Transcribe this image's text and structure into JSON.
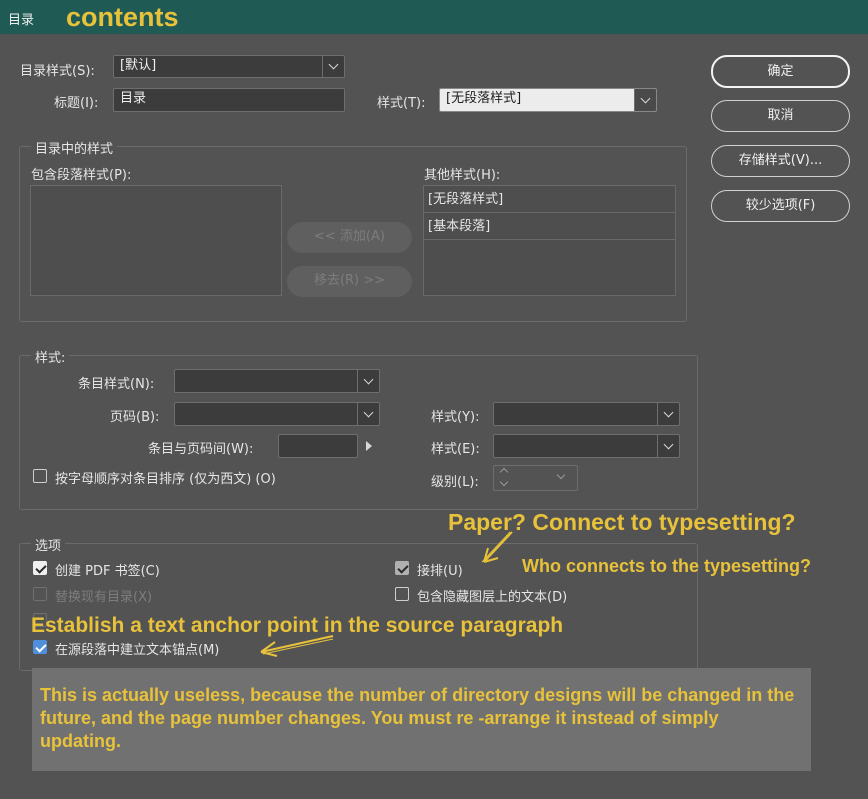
{
  "window": {
    "title": "目录"
  },
  "annotations": {
    "heading": "contents",
    "paper_question": "Paper? Connect to typesetting?",
    "who_connects": "Who connects to the typesetting?",
    "anchor_point": "Establish a text anchor point in the source paragraph",
    "note": "This is actually useless, because the number of directory designs will be changed in the future, and the page number changes. You must re -arrange it instead of simply updating."
  },
  "top": {
    "toc_style_label": "目录样式(S):",
    "toc_style_value": "[默认]",
    "title_label": "标题(I):",
    "title_value": "目录",
    "style_label": "样式(T):",
    "style_value": "[无段落样式]"
  },
  "buttons": {
    "ok": "确定",
    "cancel": "取消",
    "save_style": "存储样式(V)...",
    "fewer_options": "较少选项(F)"
  },
  "styles_in_toc": {
    "group_title": "目录中的样式",
    "include_label": "包含段落样式(P):",
    "other_label": "其他样式(H):",
    "add_button": "<< 添加(A)",
    "remove_button": "移去(R) >>",
    "other_items": [
      "[无段落样式]",
      "[基本段落]"
    ]
  },
  "style_section": {
    "group_title": "样式:",
    "entry_style_label": "条目样式(N):",
    "page_number_label": "页码(B):",
    "between_label": "条目与页码间(W):",
    "pn_style_label": "样式(Y):",
    "between_style_label": "样式(E):",
    "level_label": "级别(L):",
    "sort_label": "按字母顺序对条目排序 (仅为西文) (O)"
  },
  "options": {
    "group_title": "选项",
    "create_pdf_bookmarks": "创建 PDF 书签(C)",
    "replace_existing": "替换现有目录(X)",
    "run_in": "接排(U)",
    "include_hidden": "包含隐藏图层上的文本(D)",
    "make_anchor": "在源段落中建立文本锚点(M)"
  },
  "colors": {
    "annotation": "#e8c23a",
    "titlebar": "#1f5a55",
    "dialog_bg": "#535353"
  }
}
